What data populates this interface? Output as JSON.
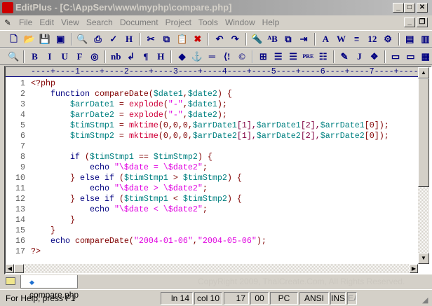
{
  "title": "EditPlus - [C:\\AppServ\\www\\myphp\\compare.php]",
  "menu": [
    "File",
    "Edit",
    "View",
    "Search",
    "Document",
    "Project",
    "Tools",
    "Window",
    "Help"
  ],
  "toolbar1": [
    {
      "icon": "new-file-icon",
      "g": "🗋"
    },
    {
      "icon": "open-folder-icon",
      "g": "📂"
    },
    {
      "icon": "save-icon",
      "g": "💾"
    },
    {
      "icon": "save-all-icon",
      "g": "▣"
    },
    {
      "sep": true
    },
    {
      "icon": "print-preview-icon",
      "g": "🔍"
    },
    {
      "icon": "print-icon",
      "g": "⎙"
    },
    {
      "icon": "spellcheck-icon",
      "g": "✓"
    },
    {
      "icon": "html-preview-icon",
      "g": "H"
    },
    {
      "sep": true
    },
    {
      "icon": "cut-icon",
      "g": "✂"
    },
    {
      "icon": "copy-icon",
      "g": "⧉"
    },
    {
      "icon": "paste-icon",
      "g": "📋"
    },
    {
      "icon": "delete-icon",
      "g": "✖"
    },
    {
      "sep": true
    },
    {
      "icon": "undo-icon",
      "g": "↶"
    },
    {
      "icon": "redo-icon",
      "g": "↷"
    },
    {
      "sep": true
    },
    {
      "icon": "find-icon",
      "g": "🔦"
    },
    {
      "icon": "replace-icon",
      "g": "ᴬB"
    },
    {
      "icon": "find-in-files-icon",
      "g": "⧉"
    },
    {
      "icon": "goto-line-icon",
      "g": "⇥"
    },
    {
      "sep": true
    },
    {
      "icon": "font-icon",
      "g": "A"
    },
    {
      "icon": "word-wrap-icon",
      "g": "W"
    },
    {
      "icon": "line-number-icon",
      "g": "≡"
    },
    {
      "icon": "column-icon",
      "g": "12"
    },
    {
      "icon": "preferences-icon",
      "g": "⚙"
    },
    {
      "sep": true
    },
    {
      "icon": "directory-window-icon",
      "g": "▤"
    },
    {
      "icon": "cliptext-window-icon",
      "g": "▥"
    }
  ],
  "toolbar2": [
    {
      "icon": "browser-view-icon",
      "g": "🔍"
    },
    {
      "sep": true
    },
    {
      "icon": "bold-icon",
      "g": "B"
    },
    {
      "icon": "italic-icon",
      "g": "I"
    },
    {
      "icon": "underline-icon",
      "g": "U"
    },
    {
      "icon": "font-tag-icon",
      "g": "F"
    },
    {
      "icon": "color-icon",
      "g": "◎"
    },
    {
      "sep": true
    },
    {
      "icon": "nbsp-icon",
      "g": "nb"
    },
    {
      "icon": "line-break-icon",
      "g": "↲"
    },
    {
      "icon": "paragraph-icon",
      "g": "¶"
    },
    {
      "icon": "heading-icon",
      "g": "H"
    },
    {
      "sep": true
    },
    {
      "icon": "image-icon",
      "g": "◆"
    },
    {
      "icon": "anchor-icon",
      "g": "⚓"
    },
    {
      "icon": "horizontal-rule-icon",
      "g": "═"
    },
    {
      "icon": "comment-icon",
      "g": "⟨!"
    },
    {
      "icon": "copyright-icon",
      "g": "©"
    },
    {
      "sep": true
    },
    {
      "icon": "table-icon",
      "g": "⊞"
    },
    {
      "icon": "center-icon",
      "g": "☰"
    },
    {
      "icon": "align-right-icon",
      "g": "☰"
    },
    {
      "icon": "pre-icon",
      "g": "PRE"
    },
    {
      "icon": "list-icon",
      "g": "☷"
    },
    {
      "sep": true
    },
    {
      "icon": "form-icon",
      "g": "✎"
    },
    {
      "icon": "javascript-icon",
      "g": "J"
    },
    {
      "icon": "objects-icon",
      "g": "❖"
    },
    {
      "sep": true
    },
    {
      "icon": "frame-icon",
      "g": "▭"
    },
    {
      "icon": "div-icon",
      "g": "▭"
    },
    {
      "icon": "palette-icon",
      "g": "▦"
    }
  ],
  "ruler": "----+----1----+----2----+----3----+----4----+----5----+----6----+----7----+----8",
  "code": [
    {
      "n": "1",
      "t": [
        [
          "<?php",
          "p"
        ]
      ]
    },
    {
      "n": "2",
      "t": [
        [
          "    ",
          ""
        ],
        [
          "function ",
          "k"
        ],
        [
          "compareDate(",
          "f"
        ],
        [
          "$date1",
          "v"
        ],
        [
          ",",
          "p"
        ],
        [
          "$date2",
          "v"
        ],
        [
          ") {",
          "p"
        ]
      ]
    },
    {
      "n": "3",
      "t": [
        [
          "        ",
          ""
        ],
        [
          "$arrDate1",
          "v"
        ],
        [
          " = ",
          "p"
        ],
        [
          "explode",
          "b"
        ],
        [
          "(",
          "p"
        ],
        [
          "\"-\"",
          "s"
        ],
        [
          ",",
          "p"
        ],
        [
          "$date1",
          "v"
        ],
        [
          ");",
          "p"
        ]
      ]
    },
    {
      "n": "4",
      "t": [
        [
          "        ",
          ""
        ],
        [
          "$arrDate2",
          "v"
        ],
        [
          " = ",
          "p"
        ],
        [
          "explode",
          "b"
        ],
        [
          "(",
          "p"
        ],
        [
          "\"-\"",
          "s"
        ],
        [
          ",",
          "p"
        ],
        [
          "$date2",
          "v"
        ],
        [
          ");",
          "p"
        ]
      ]
    },
    {
      "n": "5",
      "t": [
        [
          "        ",
          ""
        ],
        [
          "$timStmp1",
          "v"
        ],
        [
          " = ",
          "p"
        ],
        [
          "mktime",
          "b"
        ],
        [
          "(0,0,0,",
          "p"
        ],
        [
          "$arrDate1",
          "v"
        ],
        [
          "[1],",
          "n"
        ],
        [
          "$arrDate1",
          "v"
        ],
        [
          "[2],",
          "n"
        ],
        [
          "$arrDate1",
          "v"
        ],
        [
          "[0]);",
          "p"
        ]
      ]
    },
    {
      "n": "6",
      "t": [
        [
          "        ",
          ""
        ],
        [
          "$timStmp2",
          "v"
        ],
        [
          " = ",
          "p"
        ],
        [
          "mktime",
          "b"
        ],
        [
          "(0,0,0,",
          "p"
        ],
        [
          "$arrDate2",
          "v"
        ],
        [
          "[1],",
          "n"
        ],
        [
          "$arrDate2",
          "v"
        ],
        [
          "[2],",
          "n"
        ],
        [
          "$arrDate2",
          "v"
        ],
        [
          "[0]);",
          "p"
        ]
      ]
    },
    {
      "n": "7",
      "t": []
    },
    {
      "n": "8",
      "t": [
        [
          "        ",
          ""
        ],
        [
          "if ",
          "k"
        ],
        [
          "(",
          "p"
        ],
        [
          "$timStmp1",
          "v"
        ],
        [
          " == ",
          "p"
        ],
        [
          "$timStmp2",
          "v"
        ],
        [
          ") {",
          "p"
        ]
      ]
    },
    {
      "n": "9",
      "t": [
        [
          "            ",
          ""
        ],
        [
          "echo ",
          "k"
        ],
        [
          "\"\\$date = \\$date2\"",
          "s"
        ],
        [
          ";",
          "p"
        ]
      ]
    },
    {
      "n": "10",
      "t": [
        [
          "        ",
          ""
        ],
        [
          "} ",
          "p"
        ],
        [
          "else if ",
          "k"
        ],
        [
          "(",
          "p"
        ],
        [
          "$timStmp1",
          "v"
        ],
        [
          " > ",
          "p"
        ],
        [
          "$timStmp2",
          "v"
        ],
        [
          ") {",
          "p"
        ]
      ]
    },
    {
      "n": "11",
      "t": [
        [
          "            ",
          ""
        ],
        [
          "echo ",
          "k"
        ],
        [
          "\"\\$date > \\$date2\"",
          "s"
        ],
        [
          ";",
          "p"
        ]
      ]
    },
    {
      "n": "12",
      "t": [
        [
          "        ",
          ""
        ],
        [
          "} ",
          "p"
        ],
        [
          "else if ",
          "k"
        ],
        [
          "(",
          "p"
        ],
        [
          "$timStmp1",
          "v"
        ],
        [
          " < ",
          "p"
        ],
        [
          "$timStmp2",
          "v"
        ],
        [
          ") {",
          "p"
        ]
      ]
    },
    {
      "n": "13",
      "t": [
        [
          "            ",
          ""
        ],
        [
          "echo ",
          "k"
        ],
        [
          "\"\\$date < \\$date2\"",
          "s"
        ],
        [
          ";",
          "p"
        ]
      ]
    },
    {
      "n": "14",
      "t": [
        [
          "        ",
          ""
        ],
        [
          "}",
          "p"
        ]
      ]
    },
    {
      "n": "15",
      "t": [
        [
          "    ",
          ""
        ],
        [
          "}",
          "p"
        ]
      ]
    },
    {
      "n": "16",
      "t": [
        [
          "    ",
          ""
        ],
        [
          "echo ",
          "k"
        ],
        [
          "compareDate(",
          "f"
        ],
        [
          "\"2004-01-06\"",
          "s"
        ],
        [
          ",",
          "p"
        ],
        [
          "\"2004-05-06\"",
          "s"
        ],
        [
          ");",
          "p"
        ]
      ]
    },
    {
      "n": "17",
      "t": [
        [
          "?>",
          "p"
        ]
      ]
    }
  ],
  "tab": {
    "label": "compare.php"
  },
  "watermark": "CopyRight 2009, ThaiCreate.Com, All Rights Reserved.",
  "status": {
    "help": "For Help, press F1",
    "line": "ln 14",
    "col": "col 10",
    "total": "17",
    "cc": "00",
    "mode": "PC",
    "encoding": "ANSI",
    "ins": "INS",
    "extra": "EAI"
  }
}
